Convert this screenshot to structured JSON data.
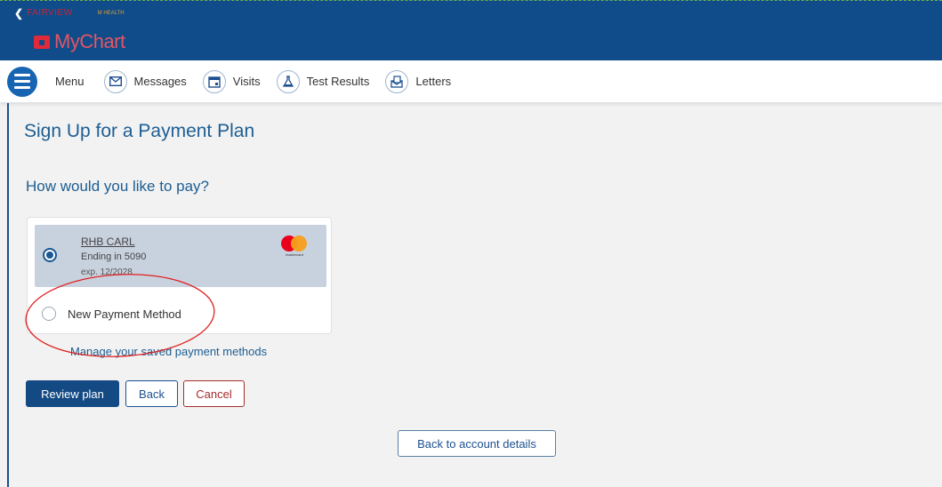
{
  "header": {
    "org_logo_text": "FAIRVIEW",
    "org_logo_subtext": "M HEALTH",
    "brand_name": "MyChart"
  },
  "nav": {
    "menu_label": "Menu",
    "items": [
      {
        "label": "Messages",
        "icon": "envelope-icon"
      },
      {
        "label": "Visits",
        "icon": "calendar-icon"
      },
      {
        "label": "Test Results",
        "icon": "flask-icon"
      },
      {
        "label": "Letters",
        "icon": "letter-icon"
      }
    ]
  },
  "page": {
    "title": "Sign Up for a Payment Plan",
    "question": "How would you like to pay?"
  },
  "payment": {
    "saved_card": {
      "name": "RHB CARL",
      "ending": "Ending in 5090",
      "expiry": "exp. 12/2028",
      "brand": "mastercard",
      "selected": true
    },
    "new_method_label": "New Payment Method",
    "manage_link": "Manage your saved payment methods"
  },
  "buttons": {
    "review": "Review plan",
    "back": "Back",
    "cancel": "Cancel",
    "account": "Back to account details"
  },
  "colors": {
    "banner": "#0f4c89",
    "primary": "#144a83",
    "accent_link": "#1d5e93",
    "cancel": "#a42d2d",
    "annotation": "#e02020"
  }
}
